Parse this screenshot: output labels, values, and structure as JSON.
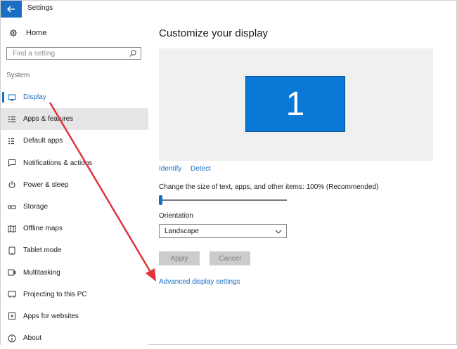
{
  "window": {
    "title": "Settings"
  },
  "sidebar": {
    "home_label": "Home",
    "search_placeholder": "Find a setting",
    "section_label": "System",
    "items": [
      {
        "label": "Display",
        "icon": "monitor-icon"
      },
      {
        "label": "Apps & features",
        "icon": "apps-list-icon"
      },
      {
        "label": "Default apps",
        "icon": "default-apps-icon"
      },
      {
        "label": "Notifications & actions",
        "icon": "notifications-icon"
      },
      {
        "label": "Power & sleep",
        "icon": "power-icon"
      },
      {
        "label": "Storage",
        "icon": "storage-icon"
      },
      {
        "label": "Offline maps",
        "icon": "map-icon"
      },
      {
        "label": "Tablet mode",
        "icon": "tablet-icon"
      },
      {
        "label": "Multitasking",
        "icon": "multitasking-icon"
      },
      {
        "label": "Projecting to this PC",
        "icon": "projecting-icon"
      },
      {
        "label": "Apps for websites",
        "icon": "apps-websites-icon"
      },
      {
        "label": "About",
        "icon": "info-icon"
      }
    ]
  },
  "main": {
    "title": "Customize your display",
    "display_number": "1",
    "identify_label": "Identify",
    "detect_label": "Detect",
    "scale_label": "Change the size of text, apps, and other items: 100% (Recommended)",
    "orientation_label": "Orientation",
    "orientation_value": "Landscape",
    "apply_label": "Apply",
    "cancel_label": "Cancel",
    "advanced_link": "Advanced display settings"
  },
  "colors": {
    "accent": "#1a6fc4",
    "monitor": "#0a78d7",
    "annotation_arrow": "#e0353b",
    "hover_bg": "#e6e6e6"
  }
}
